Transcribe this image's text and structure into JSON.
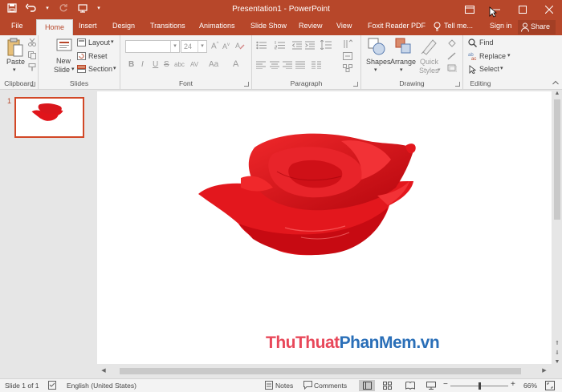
{
  "window": {
    "title": "Presentation1 - PowerPoint",
    "colors": {
      "accent": "#b7472a",
      "ribbon": "#f3f3f3",
      "selection": "#d24726"
    }
  },
  "qat": {
    "icons": [
      "save-icon",
      "undo-icon",
      "redo-icon",
      "customize-icon"
    ]
  },
  "window_controls": {
    "icons": [
      "ribbon-display-icon",
      "minimize-icon",
      "maximize-icon",
      "close-icon"
    ]
  },
  "tabs": [
    {
      "label": "File"
    },
    {
      "label": "Home"
    },
    {
      "label": "Insert"
    },
    {
      "label": "Design"
    },
    {
      "label": "Transitions"
    },
    {
      "label": "Animations"
    },
    {
      "label": "Slide Show"
    },
    {
      "label": "Review"
    },
    {
      "label": "View"
    },
    {
      "label": "Foxit Reader PDF"
    }
  ],
  "tell_me": "Tell me...",
  "sign_in": "Sign in",
  "share": "Share",
  "ribbon": {
    "clipboard": {
      "paste": "Paste",
      "label": "Clipboard"
    },
    "slides": {
      "new_slide_1": "New",
      "new_slide_2": "Slide",
      "layout": "Layout",
      "reset": "Reset",
      "section": "Section",
      "label": "Slides"
    },
    "font": {
      "size": "24",
      "label": "Font",
      "bold": "B",
      "italic": "I",
      "underline": "U",
      "strike": "S",
      "shadow": "abc",
      "spacing": "AV",
      "case": "Aa",
      "color": "A"
    },
    "paragraph": {
      "label": "Paragraph"
    },
    "drawing": {
      "shapes": "Shapes",
      "arrange": "Arrange",
      "quick_1": "Quick",
      "quick_2": "Styles",
      "label": "Drawing"
    },
    "editing": {
      "find": "Find",
      "replace": "Replace",
      "select": "Select",
      "label": "Editing"
    }
  },
  "thumbnail": {
    "number": "1"
  },
  "watermark": {
    "part1": "Thu",
    "part2": "Thuat",
    "part3": "Phan",
    "part4": "Mem",
    "part5": ".vn"
  },
  "status": {
    "slide": "Slide 1 of 1",
    "language": "English (United States)",
    "notes": "Notes",
    "comments": "Comments",
    "zoom": "66%",
    "zoom_level": 0.5
  }
}
